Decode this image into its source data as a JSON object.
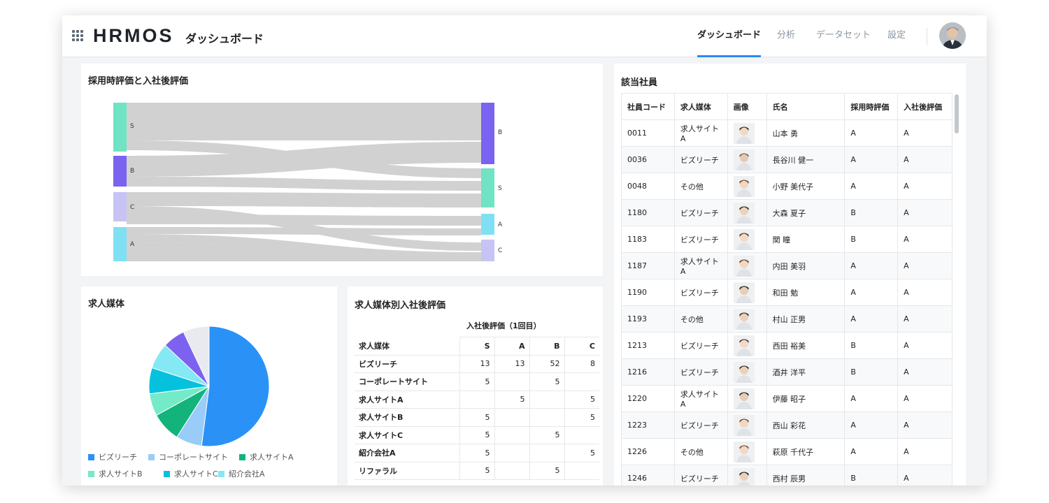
{
  "header": {
    "logo": "HRMOS",
    "page_title": "ダッシュボード",
    "nav": [
      {
        "label": "ダッシュボード",
        "active": true
      },
      {
        "label": "分析",
        "active": false
      },
      {
        "label": "データセット",
        "active": false
      },
      {
        "label": "設定",
        "active": false
      }
    ],
    "icons": [
      "apps-grid-icon",
      "user-avatar"
    ]
  },
  "sankey_card": {
    "title": "採用時評価と入社後評価",
    "left_nodes": [
      "S",
      "B",
      "C",
      "A"
    ],
    "right_nodes": [
      "B",
      "S",
      "A",
      "C"
    ],
    "node_colors": {
      "S": "#6fe3c3",
      "B": "#7a63f0",
      "C": "#c8c3f5",
      "A": "#7fe0f4"
    }
  },
  "pie_card": {
    "title": "求人媒体",
    "chart_data": {
      "type": "pie",
      "categories": [
        "ビズリーチ",
        "コーポレートサイト",
        "求人サイトA",
        "求人サイトB",
        "求人サイトC",
        "紹介会社A",
        "リファラル",
        "その他"
      ],
      "values": [
        52,
        7,
        8,
        6,
        7,
        7,
        6,
        7
      ],
      "colors": [
        "#2a92f7",
        "#99ccf8",
        "#14b37c",
        "#73ebc8",
        "#06c1dd",
        "#84e8f5",
        "#7c62ee",
        "#e8eaef"
      ],
      "legend_placement": "bottom"
    },
    "legend": [
      "ビズリーチ",
      "コーポレートサイト",
      "求人サイトA",
      "求人サイトB",
      "求人サイトC",
      "紹介会社A"
    ]
  },
  "xtab_card": {
    "title": "求人媒体別入社後評価",
    "subtitle": "入社後評価（1回目）",
    "row_header": "求人媒体",
    "columns": [
      "S",
      "A",
      "B",
      "C"
    ],
    "rows": [
      {
        "label": "ビズリーチ",
        "cells": [
          "13",
          "13",
          "52",
          "8"
        ]
      },
      {
        "label": "コーポレートサイト",
        "cells": [
          "5",
          "",
          "5",
          ""
        ]
      },
      {
        "label": "求人サイトA",
        "cells": [
          "",
          "5",
          "",
          "5"
        ]
      },
      {
        "label": "求人サイトB",
        "cells": [
          "5",
          "",
          "",
          "5"
        ]
      },
      {
        "label": "求人サイトC",
        "cells": [
          "5",
          "",
          "5",
          ""
        ]
      },
      {
        "label": "紹介会社A",
        "cells": [
          "5",
          "",
          "",
          "5"
        ]
      },
      {
        "label": "リファラル",
        "cells": [
          "5",
          "",
          "5",
          ""
        ]
      }
    ]
  },
  "employee_card": {
    "title": "該当社員",
    "columns": [
      "社員コード",
      "求人媒体",
      "画像",
      "氏名",
      "採用時評価",
      "入社後評価"
    ],
    "rows": [
      {
        "code": "0011",
        "media": "求人サイトA",
        "name": "山本 勇",
        "hire": "A",
        "after": "A"
      },
      {
        "code": "0036",
        "media": "ビズリーチ",
        "name": "長谷川 健一",
        "hire": "A",
        "after": "A"
      },
      {
        "code": "0048",
        "media": "その他",
        "name": "小野 美代子",
        "hire": "A",
        "after": "A"
      },
      {
        "code": "1180",
        "media": "ビズリーチ",
        "name": "大森 夏子",
        "hire": "B",
        "after": "A"
      },
      {
        "code": "1183",
        "media": "ビズリーチ",
        "name": "関 瞳",
        "hire": "B",
        "after": "A"
      },
      {
        "code": "1187",
        "media": "求人サイトA",
        "name": "内田 美羽",
        "hire": "A",
        "after": "A"
      },
      {
        "code": "1190",
        "media": "ビズリーチ",
        "name": "和田 勉",
        "hire": "A",
        "after": "A"
      },
      {
        "code": "1193",
        "media": "その他",
        "name": "村山 正男",
        "hire": "A",
        "after": "A"
      },
      {
        "code": "1213",
        "media": "ビズリーチ",
        "name": "西田 裕美",
        "hire": "B",
        "after": "A"
      },
      {
        "code": "1216",
        "media": "ビズリーチ",
        "name": "酒井 洋平",
        "hire": "B",
        "after": "A"
      },
      {
        "code": "1220",
        "media": "求人サイトA",
        "name": "伊藤 昭子",
        "hire": "A",
        "after": "A"
      },
      {
        "code": "1223",
        "media": "ビズリーチ",
        "name": "西山 彩花",
        "hire": "A",
        "after": "A"
      },
      {
        "code": "1226",
        "media": "その他",
        "name": "萩原 千代子",
        "hire": "A",
        "after": "A"
      },
      {
        "code": "1246",
        "media": "ビズリーチ",
        "name": "西村 辰男",
        "hire": "B",
        "after": "A"
      }
    ]
  }
}
